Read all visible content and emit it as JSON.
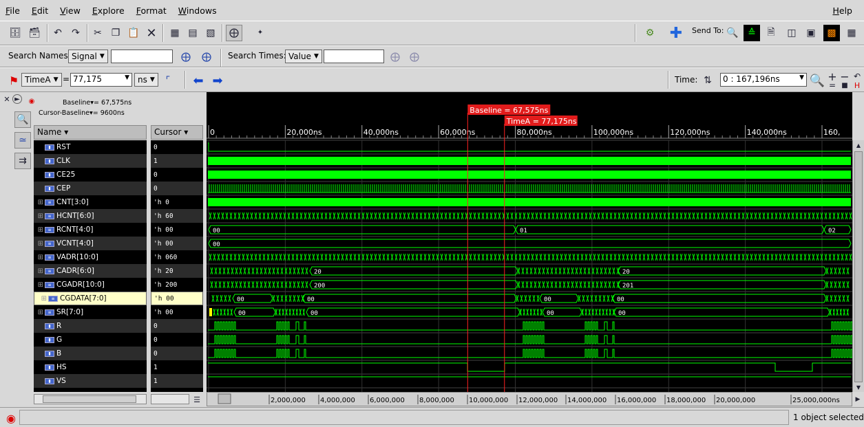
{
  "menu": [
    "File",
    "Edit",
    "View",
    "Explore",
    "Format",
    "Windows"
  ],
  "menu_help": "Help",
  "search": {
    "names_label": "Search Names:",
    "names_mode": "Signal",
    "times_label": "Search Times:",
    "times_mode": "Value"
  },
  "cursor_bar": {
    "cursor_name": "TimeA",
    "equals": "=",
    "cursor_value": "77,175",
    "unit": "ns",
    "time_label": "Time:",
    "time_range": "0 : 167,196ns"
  },
  "send_to_label": "Send To:",
  "baseline_info": {
    "baseline": "Baseline▾= 67,575ns",
    "cursor_baseline": "Cursor-Baseline▾= 9600ns"
  },
  "columns": {
    "name": "Name ▾",
    "cursor": "Cursor ▾"
  },
  "markers": {
    "baseline_label": "Baseline = 67,575ns",
    "timea_label": "TimeA = 77,175ns",
    "baseline_ns": 67575,
    "timea_ns": 77175
  },
  "timeline": {
    "max_ns": 167196,
    "ticks": [
      "0",
      "20,000ns",
      "40,000ns",
      "60,000ns",
      "80,000ns",
      "100,000ns",
      "120,000ns",
      "140,000ns",
      "160,"
    ],
    "tick_values": [
      0,
      20000,
      40000,
      60000,
      80000,
      100000,
      120000,
      140000,
      160000
    ]
  },
  "overview_ticks": [
    "2,000,000",
    "4,000,000",
    "6,000,000",
    "8,000,000",
    "10,000,000",
    "12,000,000",
    "14,000,000",
    "16,000,000",
    "18,000,000",
    "20,000,000",
    "25,000,000ns"
  ],
  "signals": [
    {
      "name": "RST",
      "type": "bit",
      "value": "0"
    },
    {
      "name": "CLK",
      "type": "bit",
      "value": "1"
    },
    {
      "name": "CE25",
      "type": "bit",
      "value": "0"
    },
    {
      "name": "CEP",
      "type": "bit",
      "value": "0"
    },
    {
      "name": "CNT[3:0]",
      "type": "bus",
      "value": "'h 0"
    },
    {
      "name": "HCNT[6:0]",
      "type": "bus",
      "value": "'h 60"
    },
    {
      "name": "RCNT[4:0]",
      "type": "bus",
      "value": "'h 00",
      "labels": [
        "00",
        "01",
        "02"
      ]
    },
    {
      "name": "VCNT[4:0]",
      "type": "bus",
      "value": "'h 00",
      "labels": [
        "00"
      ]
    },
    {
      "name": "VADR[10:0]",
      "type": "bus",
      "value": "'h 060"
    },
    {
      "name": "CADR[6:0]",
      "type": "bus",
      "value": "'h 20",
      "labels": [
        "20",
        "20"
      ]
    },
    {
      "name": "CGADR[10:0]",
      "type": "bus",
      "value": "'h 200",
      "labels": [
        "200",
        "201"
      ]
    },
    {
      "name": "CGDATA[7:0]",
      "type": "bus",
      "value": "'h 00",
      "labels": [
        "00",
        "00",
        "00",
        "00"
      ]
    },
    {
      "name": "SR[7:0]",
      "type": "bus",
      "value": "'h 00",
      "labels": [
        "00",
        "00",
        "00",
        "00"
      ]
    },
    {
      "name": "R",
      "type": "bit",
      "value": "0"
    },
    {
      "name": "G",
      "type": "bit",
      "value": "0"
    },
    {
      "name": "B",
      "type": "bit",
      "value": "0"
    },
    {
      "name": "HS",
      "type": "bit",
      "value": "1"
    },
    {
      "name": "VS",
      "type": "bit",
      "value": "1"
    }
  ],
  "status": "1 object selected",
  "colors": {
    "wave": "#00ff00",
    "marker": "#ff2020",
    "selected_row": "#ffffc8"
  }
}
